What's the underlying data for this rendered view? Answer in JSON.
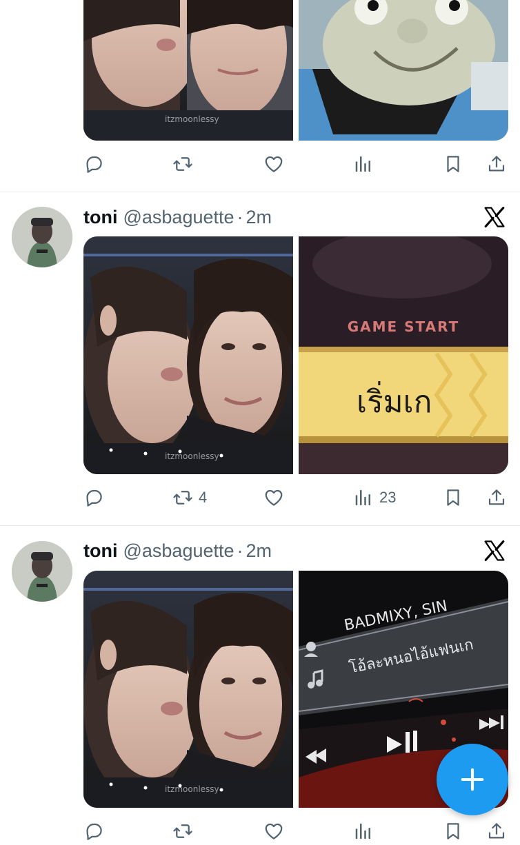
{
  "colors": {
    "accent": "#1d9bf0",
    "text_primary": "#0f1419",
    "text_secondary": "#536471",
    "divider": "#e6e9ec"
  },
  "feed": {
    "tweets": [
      {
        "name": "toni",
        "handle": "@asbaguette",
        "separator": "·",
        "time": "2m",
        "images": [
          {
            "watermark": "itzmoonlessy",
            "caption": ""
          },
          {
            "watermark": "",
            "caption": "GAME START",
            "subcaption": "เริ่มเก"
          }
        ],
        "counts": {
          "reply": "",
          "retweet": "4",
          "like": "",
          "views": "23"
        }
      },
      {
        "name": "toni",
        "handle": "@asbaguette",
        "separator": "·",
        "time": "2m",
        "images": [
          {
            "watermark": "itzmoonlessy",
            "caption": ""
          },
          {
            "watermark": "",
            "artist": "BADMIXY, SIN",
            "song": "โอ้ละหนอไอ้แฟนเก"
          }
        ],
        "counts": {
          "reply": "",
          "retweet": "",
          "like": "",
          "views": ""
        }
      }
    ],
    "top_partial": {
      "watermark": "itzmoonlessy",
      "counts": {
        "reply": "",
        "retweet": "",
        "like": "",
        "views": ""
      }
    }
  },
  "icons": {
    "reply": "reply-icon",
    "retweet": "retweet-icon",
    "like": "heart-icon",
    "views": "views-icon",
    "bookmark": "bookmark-icon",
    "share": "share-icon",
    "x_logo": "x-logo-icon",
    "compose": "plus-icon"
  }
}
